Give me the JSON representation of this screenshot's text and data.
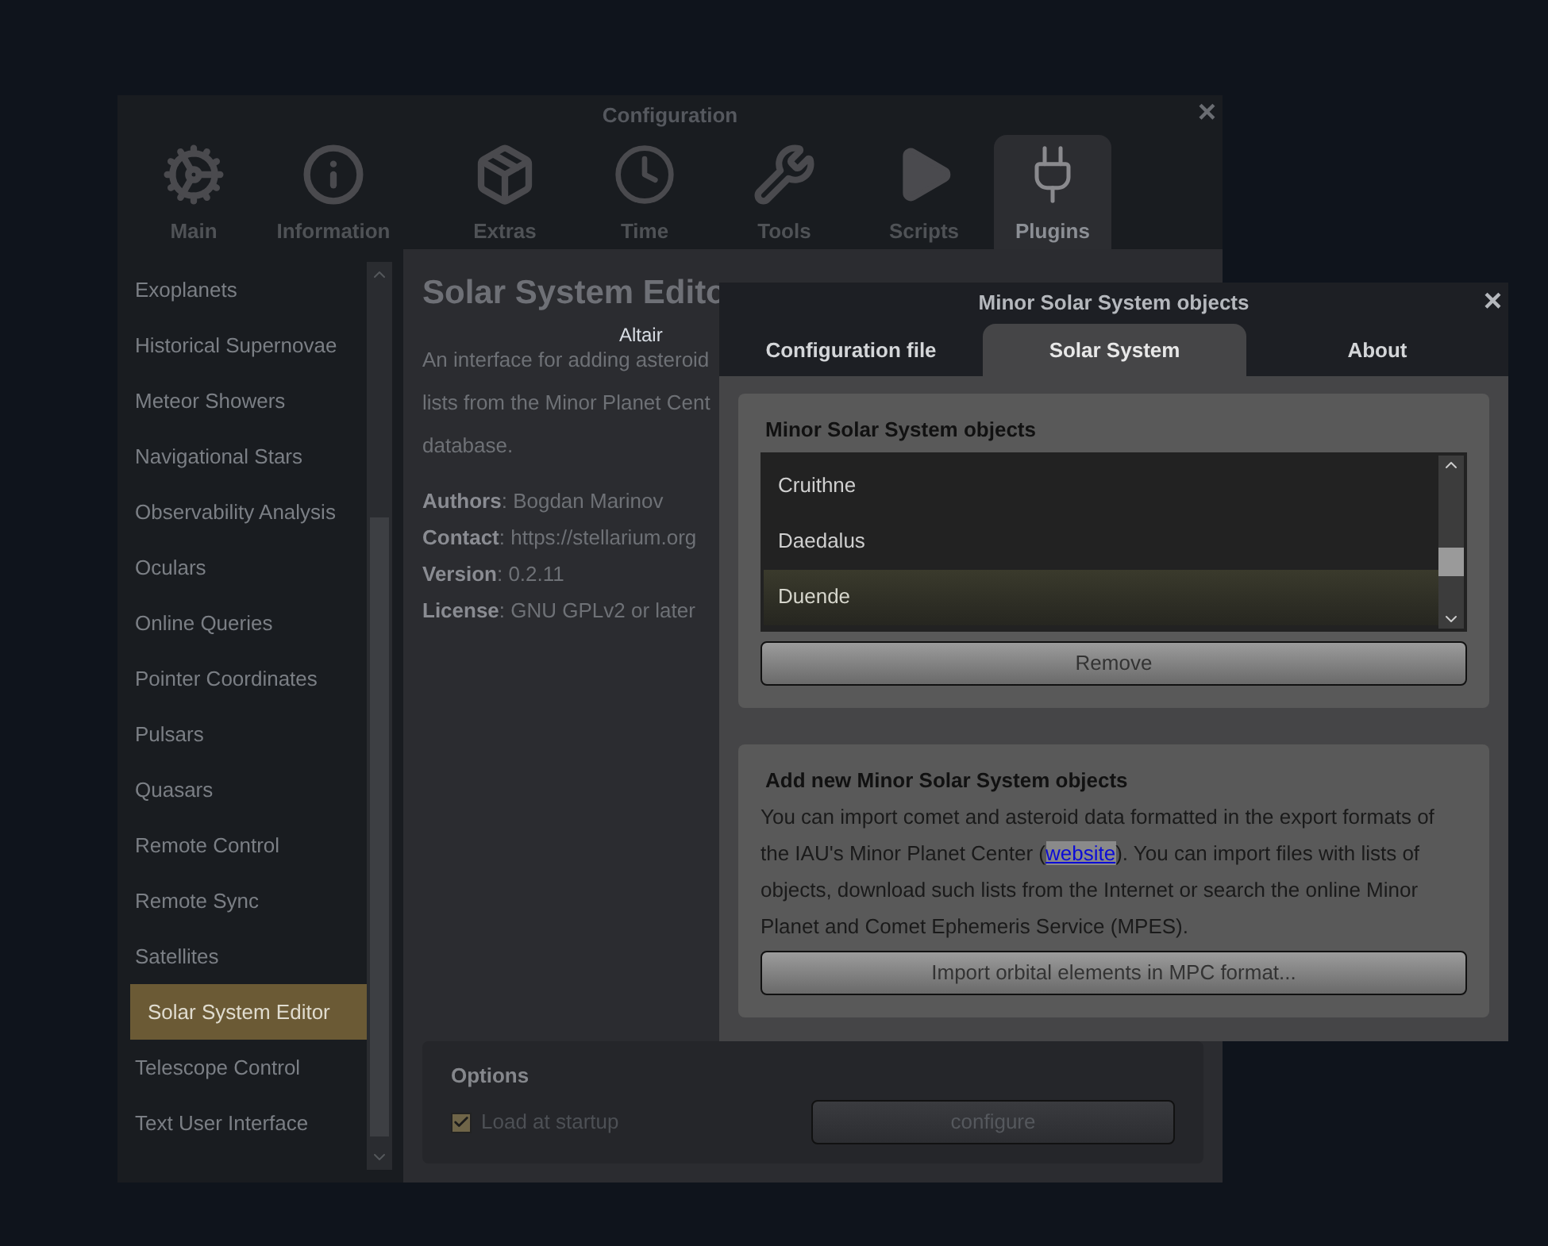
{
  "sky": {
    "label": "Altair"
  },
  "config_window": {
    "title": "Configuration",
    "close": "×",
    "tabs": [
      {
        "label": "Main",
        "selected": false
      },
      {
        "label": "Information",
        "selected": false
      },
      {
        "label": "Extras",
        "selected": false
      },
      {
        "label": "Time",
        "selected": false
      },
      {
        "label": "Tools",
        "selected": false
      },
      {
        "label": "Scripts",
        "selected": false
      },
      {
        "label": "Plugins",
        "selected": true
      }
    ],
    "plugins": [
      {
        "label": "Exoplanets",
        "selected": false
      },
      {
        "label": "Historical Supernovae",
        "selected": false
      },
      {
        "label": "Meteor Showers",
        "selected": false
      },
      {
        "label": "Navigational Stars",
        "selected": false
      },
      {
        "label": "Observability Analysis",
        "selected": false
      },
      {
        "label": "Oculars",
        "selected": false
      },
      {
        "label": "Online Queries",
        "selected": false
      },
      {
        "label": "Pointer Coordinates",
        "selected": false
      },
      {
        "label": "Pulsars",
        "selected": false
      },
      {
        "label": "Quasars",
        "selected": false
      },
      {
        "label": "Remote Control",
        "selected": false
      },
      {
        "label": "Remote Sync",
        "selected": false
      },
      {
        "label": "Satellites",
        "selected": false
      },
      {
        "label": "Solar System Editor",
        "selected": true
      },
      {
        "label": "Telescope Control",
        "selected": false
      },
      {
        "label": "Text User Interface",
        "selected": false
      }
    ],
    "plugin_title": "Solar System Edito",
    "description_lines": [
      "An interface for adding asteroid",
      "lists from the Minor Planet Cent",
      "database."
    ],
    "details": [
      "**Authors**: Bogdan Marinov",
      "**Contact**: https://stellarium.org",
      "**Version**: 0.2.11",
      "**License**: GNU GPLv2 or later"
    ],
    "options": {
      "title": "Options",
      "load_at_startup": {
        "label": "Load at startup",
        "checked": true
      },
      "configure_button": "configure"
    }
  },
  "minor_window": {
    "title": "Minor Solar System objects",
    "close": "×",
    "tabs": [
      {
        "label": "Configuration file",
        "selected": false
      },
      {
        "label": "Solar System",
        "selected": true
      },
      {
        "label": "About",
        "selected": false
      }
    ],
    "objects_group": {
      "title": "Minor Solar System objects",
      "items": [
        {
          "label": "Cruithne",
          "selected": false
        },
        {
          "label": "Daedalus",
          "selected": false
        },
        {
          "label": "Duende",
          "selected": true
        }
      ],
      "remove_button": "Remove"
    },
    "add_group": {
      "title": "Add new Minor Solar System objects",
      "text_before": "You can import comet and asteroid data formatted in the export formats of the IAU's Minor Planet Center (",
      "link": "website",
      "text_after": "). You can import files with lists of objects, download such lists from the Internet or search the online Minor Planet and Comet Ephemeris Service (MPES).",
      "import_button": "Import orbital elements in MPC format..."
    }
  }
}
